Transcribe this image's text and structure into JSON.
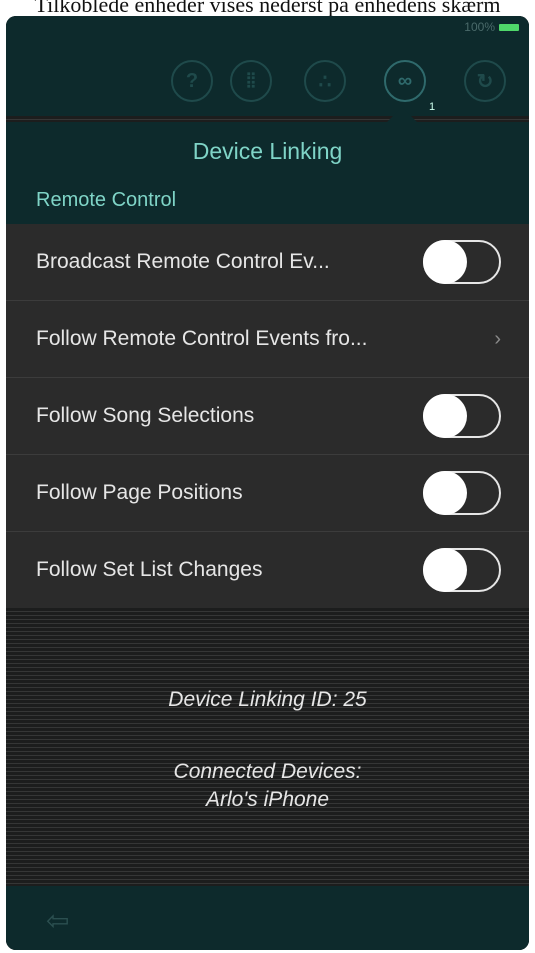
{
  "caption": "Tilkoblede enheder vises nederst på enhedens skærm",
  "status": {
    "battery": "100%"
  },
  "nav": {
    "icons": [
      "help-icon",
      "keyboard-icon",
      "midi-icon",
      "device-link-icon",
      "sync-icon"
    ],
    "badge": "1"
  },
  "popover": {
    "title": "Device Linking",
    "section": "Remote Control"
  },
  "settings": [
    {
      "label": "Broadcast Remote Control Ev...",
      "control": "toggle",
      "on": false
    },
    {
      "label": "Follow Remote Control Events fro...",
      "control": "chevron"
    },
    {
      "label": "Follow Song Selections",
      "control": "toggle",
      "on": false
    },
    {
      "label": "Follow Page Positions",
      "control": "toggle",
      "on": false
    },
    {
      "label": "Follow Set List Changes",
      "control": "toggle",
      "on": false
    }
  ],
  "info": {
    "linking_id": "Device Linking ID: 25",
    "connected_label": "Connected Devices:",
    "connected_device": "Arlo's iPhone"
  },
  "bottom": {
    "exit_icon": "exit-icon"
  },
  "colors": {
    "accent": "#7fd4c7",
    "bar": "#0d2a2c",
    "list_bg": "#2b2b2b",
    "battery": "#4fd86a"
  }
}
